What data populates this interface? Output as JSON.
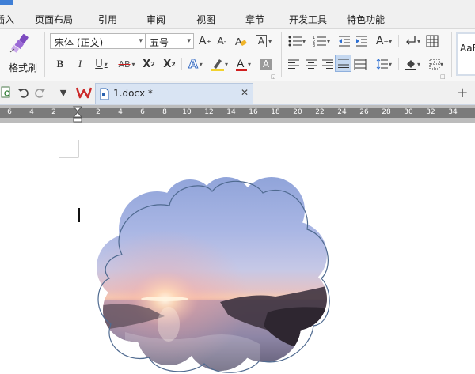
{
  "menu": {
    "items": [
      "插入",
      "页面布局",
      "引用",
      "审阅",
      "视图",
      "章节",
      "开发工具",
      "特色功能"
    ]
  },
  "ribbon": {
    "format_painter_label": "格式刷",
    "font_name": "宋体 (正文)",
    "font_size": "五号",
    "style_preview": "AaBb"
  },
  "tabs": {
    "document_name": "1.docx *"
  },
  "ruler": {
    "numbers": [
      "6",
      "4",
      "2",
      "2",
      "4",
      "6",
      "8",
      "10",
      "12",
      "14",
      "16",
      "18",
      "20",
      "22",
      "24",
      "26",
      "28",
      "30",
      "32",
      "34"
    ]
  },
  "colors": {
    "accent_blue": "#3f7fd6",
    "wps_red": "#cc2a2a",
    "highlight_yellow": "#f2d22e",
    "font_red": "#d01f1f",
    "tab_bg": "#d9e4f3",
    "ruler_band": "#7b7b7b"
  },
  "image": {
    "shape": "cloud",
    "content": "sunset over sea landscape"
  }
}
